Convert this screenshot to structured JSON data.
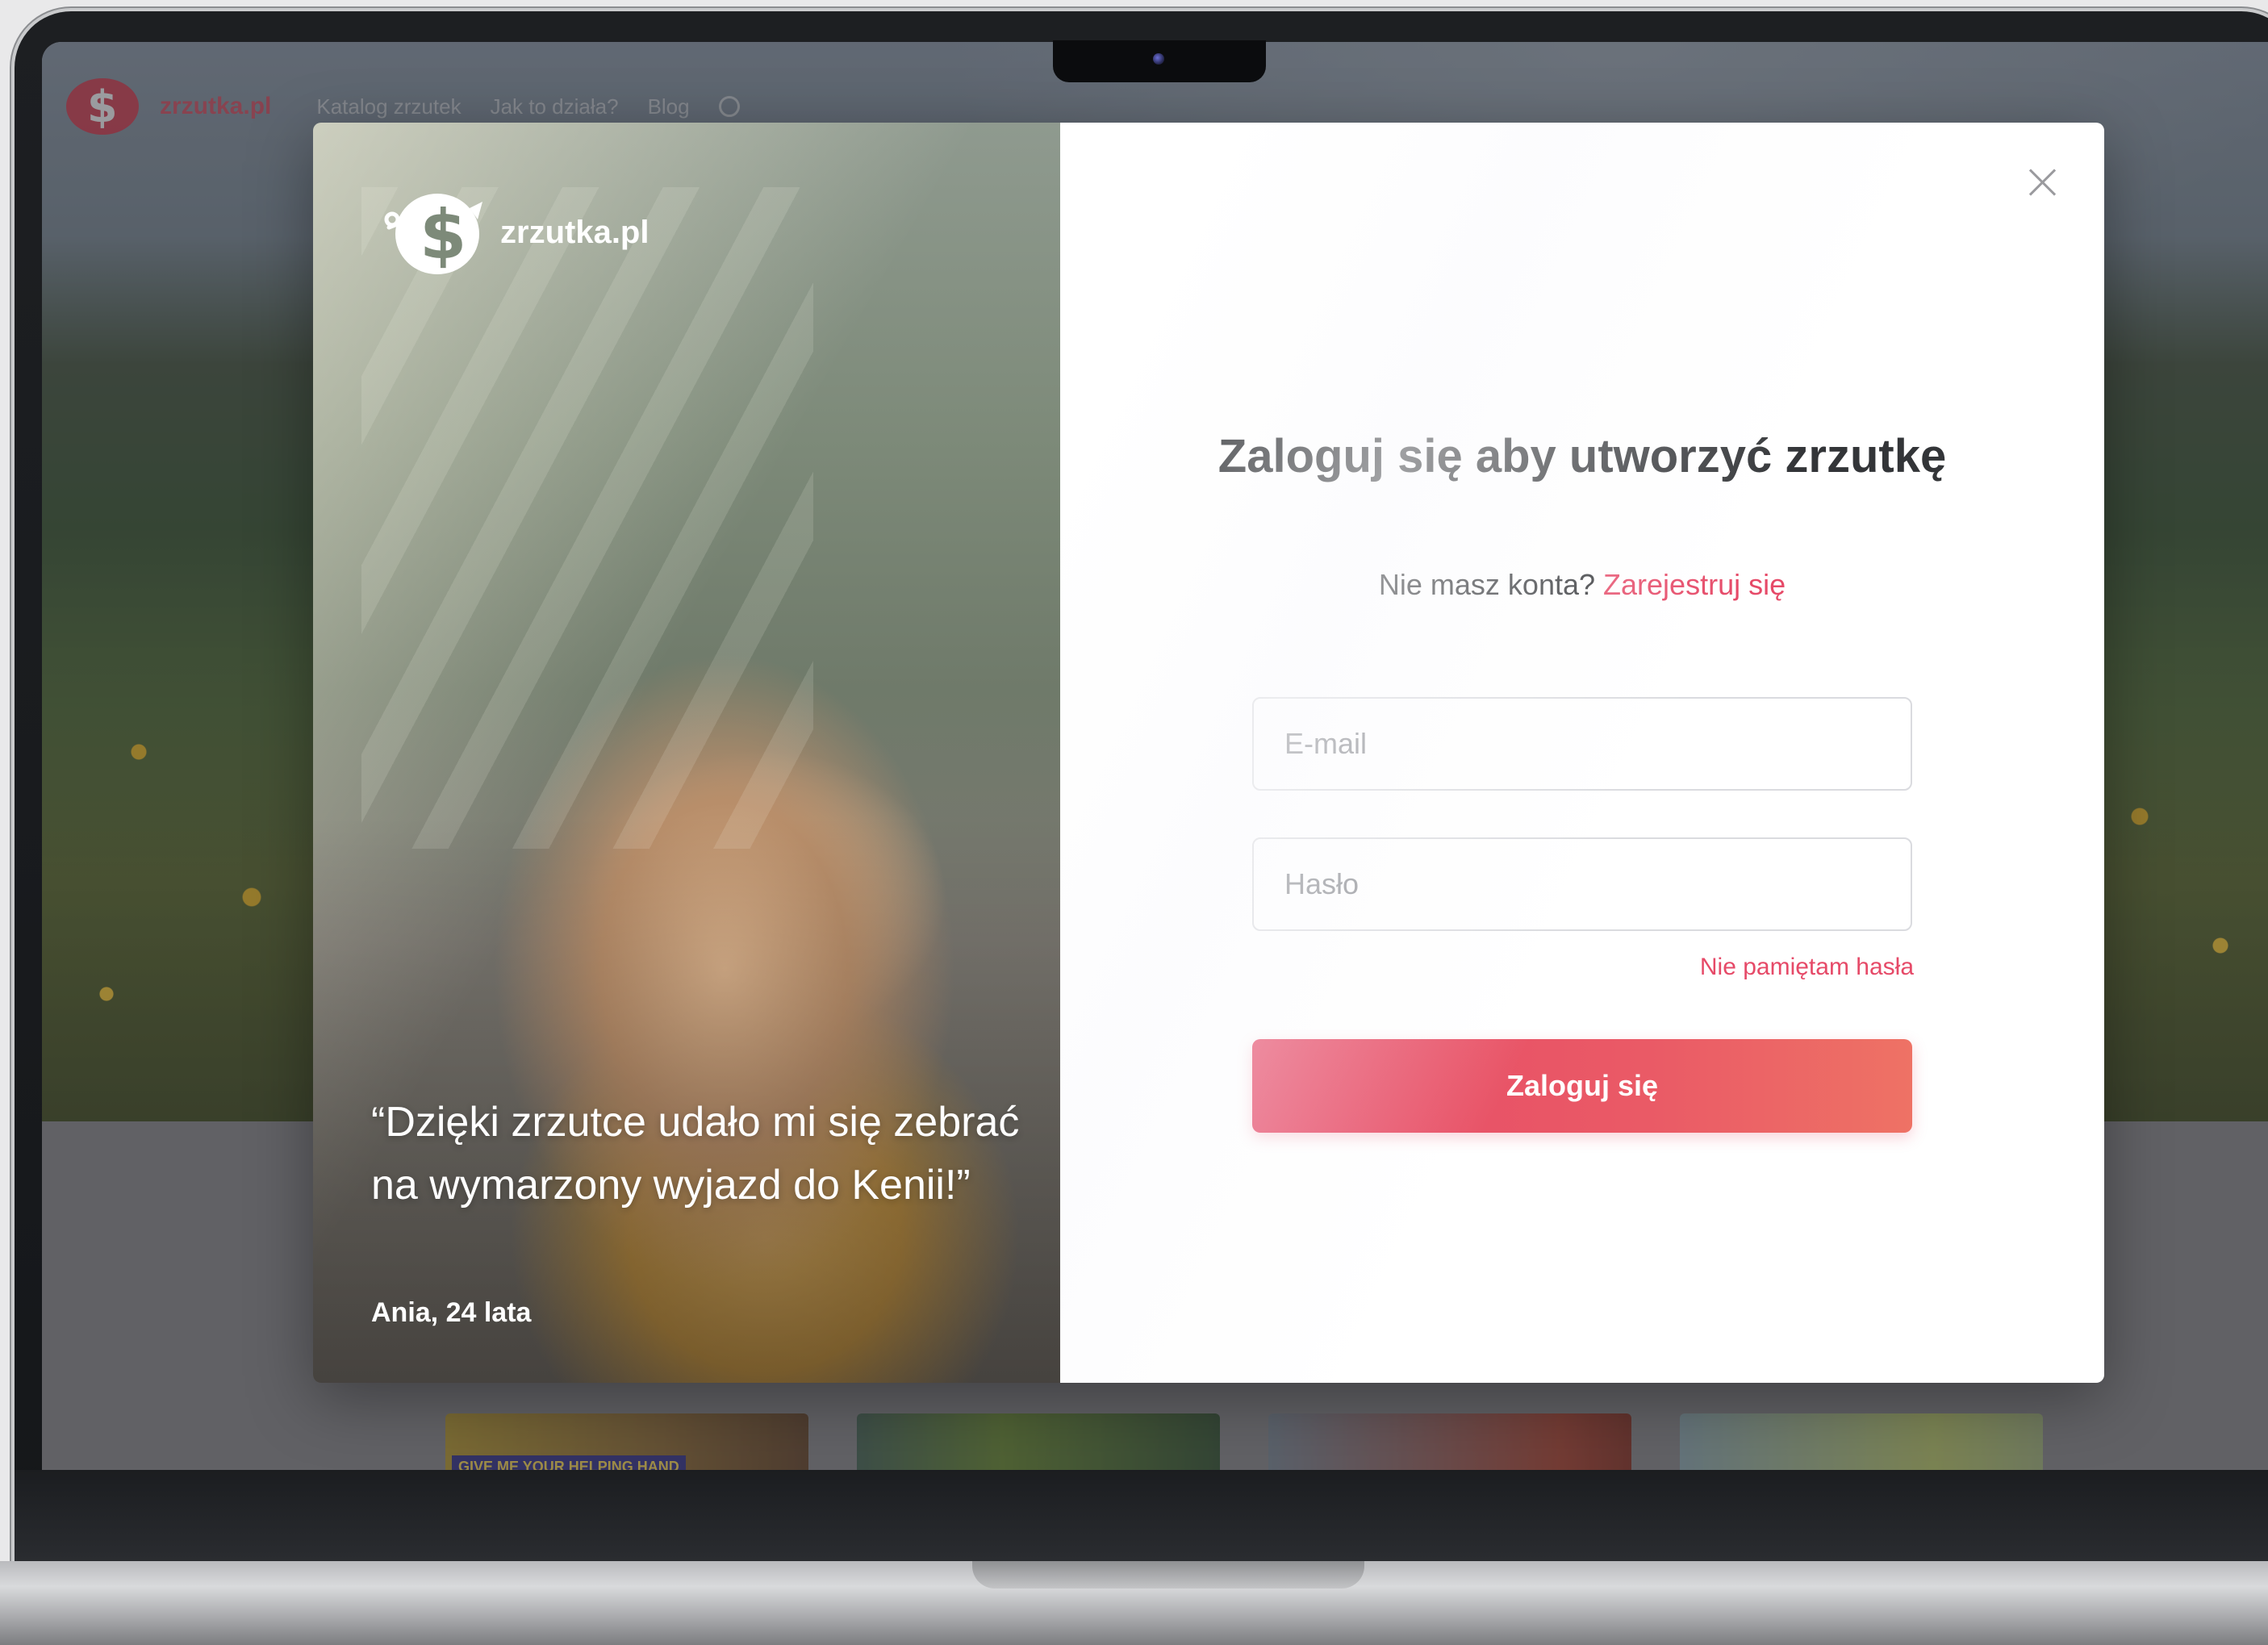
{
  "background_site": {
    "brand": "zrzutka.pl",
    "nav": [
      "Katalog zrzutek",
      "Jak to działa?",
      "Blog"
    ],
    "card_label": "GIVE ME YOUR HELPING HAND"
  },
  "modal": {
    "left": {
      "brand": "zrzutka.pl",
      "quote": "“Dzięki zrzutce udało mi się zebrać na wymarzony wyjazd do Kenii!”",
      "author": "Ania, 24 lata"
    },
    "right": {
      "title": "Zaloguj się aby utworzyć zrzutkę",
      "no_account_text": "Nie masz konta?",
      "register_link": "Zarejestruj się",
      "email_placeholder": "E-mail",
      "password_placeholder": "Hasło",
      "forgot_password": "Nie pamiętam hasła",
      "login_button": "Zaloguj się"
    }
  },
  "colors": {
    "accent": "#e64a68",
    "accent_end": "#ee7265",
    "text_dark": "#333538",
    "brand_red": "#d83a4e"
  }
}
